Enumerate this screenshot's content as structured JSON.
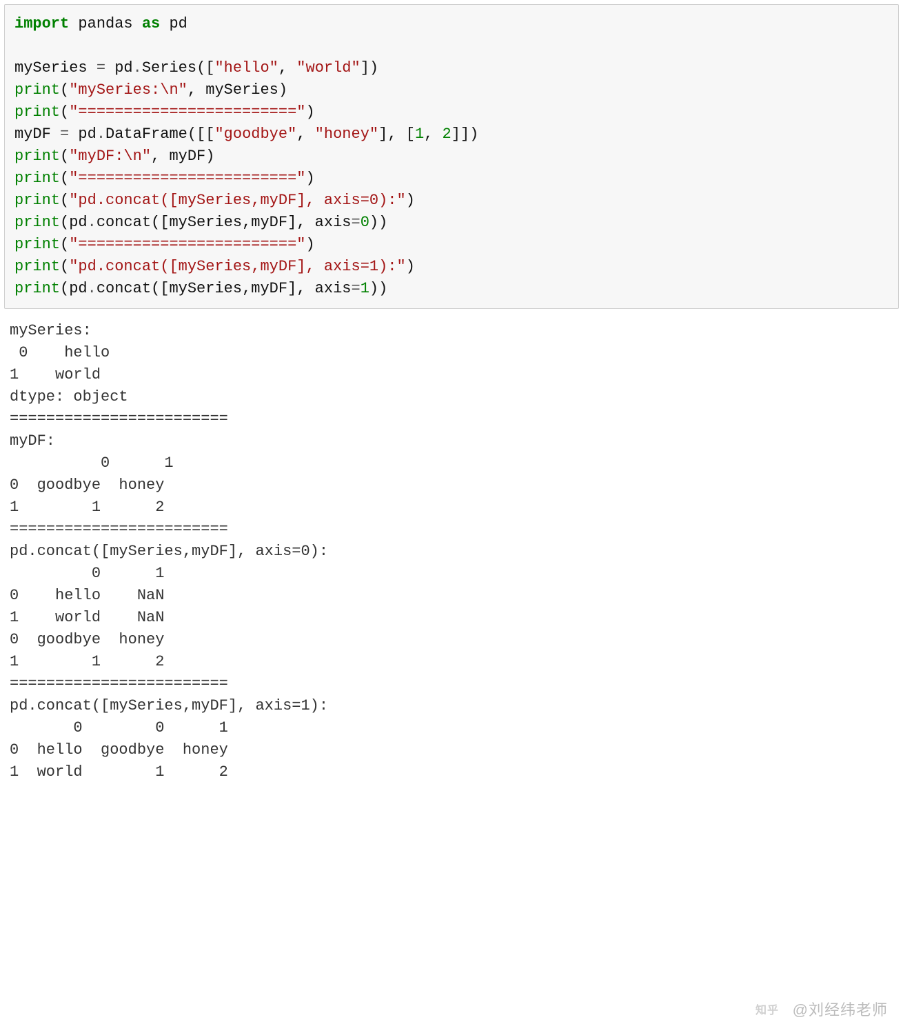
{
  "code": {
    "l1": {
      "a": "import",
      "b": " pandas ",
      "c": "as",
      "d": " pd"
    },
    "l2": "",
    "l3": {
      "a": "mySeries ",
      "op1": "=",
      "b": " pd",
      "dot": ".",
      "c": "Series",
      "p1": "([",
      "s1": "\"hello\"",
      "cm": ", ",
      "s2": "\"world\"",
      "p2": "])"
    },
    "l4": {
      "fn": "print",
      "p1": "(",
      "s1": "\"mySeries:\\n\"",
      "cm": ", mySeries",
      "p2": ")"
    },
    "l5": {
      "fn": "print",
      "p1": "(",
      "s1": "\"========================\"",
      "p2": ")"
    },
    "l6": {
      "a": "myDF ",
      "op1": "=",
      "b": " pd",
      "dot": ".",
      "c": "DataFrame",
      "p1": "([[",
      "s1": "\"goodbye\"",
      "cm1": ", ",
      "s2": "\"honey\"",
      "br": "], [",
      "n1": "1",
      "cm2": ", ",
      "n2": "2",
      "p2": "]])"
    },
    "l7": {
      "fn": "print",
      "p1": "(",
      "s1": "\"myDF:\\n\"",
      "cm": ", myDF",
      "p2": ")"
    },
    "l8": {
      "fn": "print",
      "p1": "(",
      "s1": "\"========================\"",
      "p2": ")"
    },
    "l9": {
      "fn": "print",
      "p1": "(",
      "s1": "\"pd.concat([mySeries,myDF], axis=0):\"",
      "p2": ")"
    },
    "l10": {
      "fn": "print",
      "p1": "(pd",
      "dot": ".",
      "cc": "concat",
      "p2": "([mySeries,myDF], axis",
      "op": "=",
      "n": "0",
      "p3": "))"
    },
    "l11": {
      "fn": "print",
      "p1": "(",
      "s1": "\"========================\"",
      "p2": ")"
    },
    "l12": {
      "fn": "print",
      "p1": "(",
      "s1": "\"pd.concat([mySeries,myDF], axis=1):\"",
      "p2": ")"
    },
    "l13": {
      "fn": "print",
      "p1": "(pd",
      "dot": ".",
      "cc": "concat",
      "p2": "([mySeries,myDF], axis",
      "op": "=",
      "n": "1",
      "p3": "))"
    }
  },
  "output": "mySeries:\n 0    hello\n1    world\ndtype: object\n========================\nmyDF:\n          0      1\n0  goodbye  honey\n1        1      2\n========================\npd.concat([mySeries,myDF], axis=0):\n         0      1\n0    hello    NaN\n1    world    NaN\n0  goodbye  honey\n1        1      2\n========================\npd.concat([mySeries,myDF], axis=1):\n       0        0      1\n0  hello  goodbye  honey\n1  world        1      2",
  "watermark": "@刘经纬老师"
}
